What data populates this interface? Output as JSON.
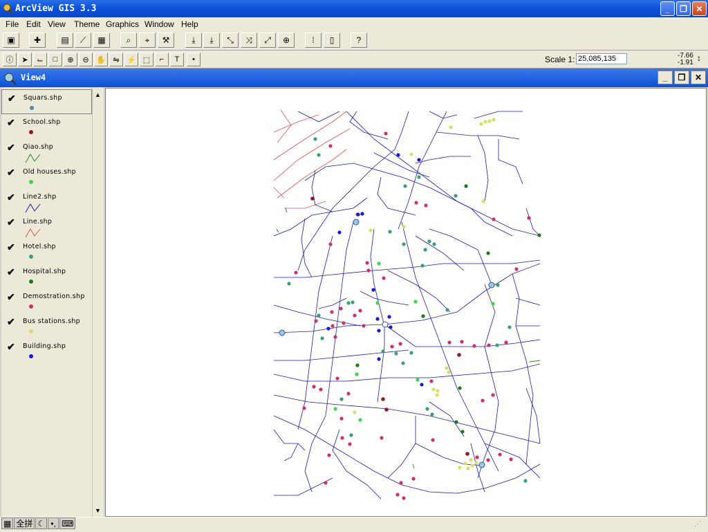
{
  "window": {
    "title": "ArcView GIS 3.3"
  },
  "menu": [
    "File",
    "Edit",
    "View",
    "Theme",
    "Graphics",
    "Window",
    "Help"
  ],
  "scale": {
    "label": "Scale 1:",
    "value": "25,085,135"
  },
  "coords": {
    "x": "-7.66",
    "y": "-1.91"
  },
  "view": {
    "title": "View4"
  },
  "layers": [
    {
      "name": "Squars.shp",
      "symbol": "point",
      "color": "#4a8ab0"
    },
    {
      "name": "School.shp",
      "symbol": "point",
      "color": "#8b1a2c"
    },
    {
      "name": "Qiao.shp",
      "symbol": "line",
      "color": "#1e8a1e"
    },
    {
      "name": "Old houses.shp",
      "symbol": "point",
      "color": "#3fd44a"
    },
    {
      "name": "Line2.shp",
      "symbol": "line",
      "color": "#1a1aa8"
    },
    {
      "name": "Line.shp",
      "symbol": "line",
      "color": "#e05050"
    },
    {
      "name": "Hotel.shp",
      "symbol": "point",
      "color": "#3a9e7a"
    },
    {
      "name": "Hospital.shp",
      "symbol": "point",
      "color": "#1b7a1b"
    },
    {
      "name": "Demostration.shp",
      "symbol": "point",
      "color": "#d0306a"
    },
    {
      "name": "Bus stations.shp",
      "symbol": "point",
      "color": "#d6e06a"
    },
    {
      "name": "Building.shp",
      "symbol": "point",
      "color": "#1a1ad0"
    }
  ],
  "ime": [
    "全拼"
  ],
  "icons": [
    "search-icon",
    "save-icon",
    "add-theme-icon",
    "properties-icon",
    "select-icon",
    "table-icon",
    "find-icon",
    "query-icon",
    "zoom-in-icon",
    "zoom-out-icon",
    "pan-icon",
    "identify-icon",
    "pointer-icon",
    "text-tool-icon",
    "help-icon"
  ]
}
